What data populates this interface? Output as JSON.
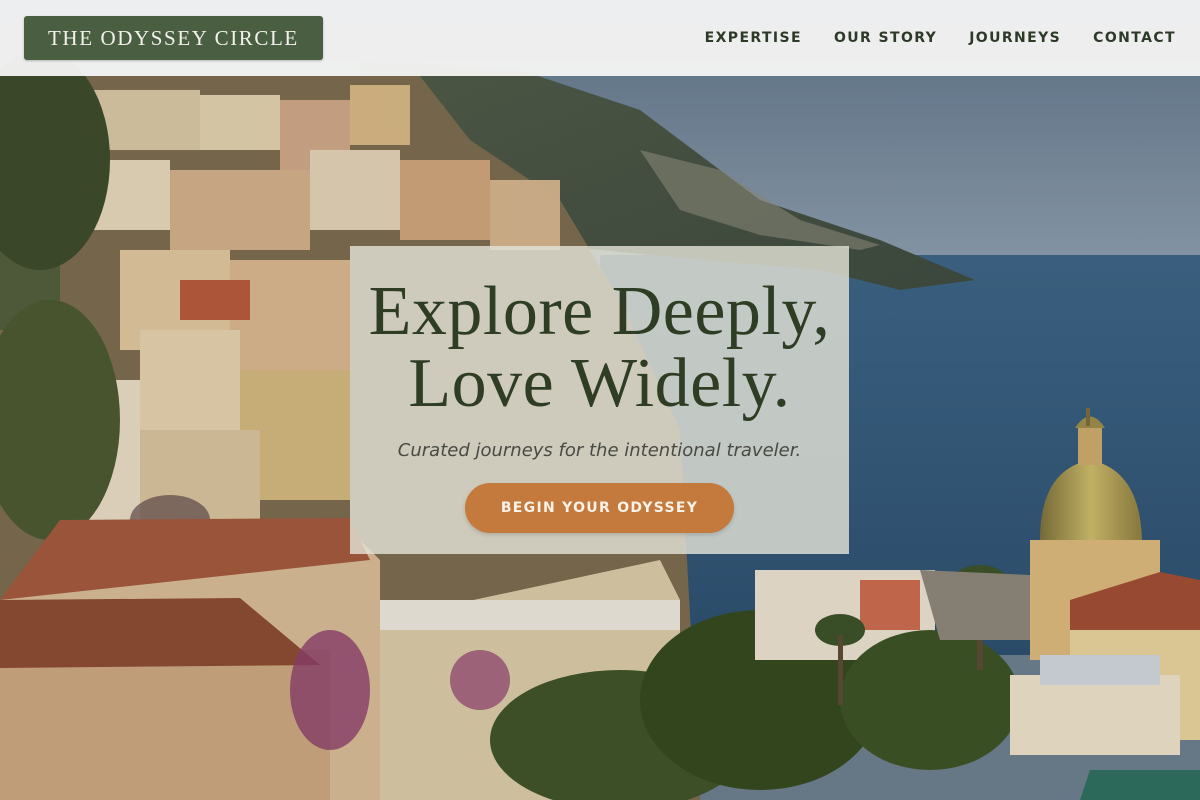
{
  "brand": {
    "name": "THE ODYSSEY CIRCLE",
    "color": "#4a5e42"
  },
  "nav": {
    "items": [
      {
        "label": "EXPERTISE"
      },
      {
        "label": "OUR STORY"
      },
      {
        "label": "JOURNEYS"
      },
      {
        "label": "CONTACT"
      }
    ]
  },
  "hero": {
    "headline_line1": "Explore Deeply,",
    "headline_line2": "Love Widely.",
    "tagline": "Curated journeys for the intentional traveler.",
    "cta_label": "BEGIN YOUR ODYSSEY",
    "cta_color": "#c47a3c",
    "image_subject": "coastal-village-hillside-photo"
  }
}
